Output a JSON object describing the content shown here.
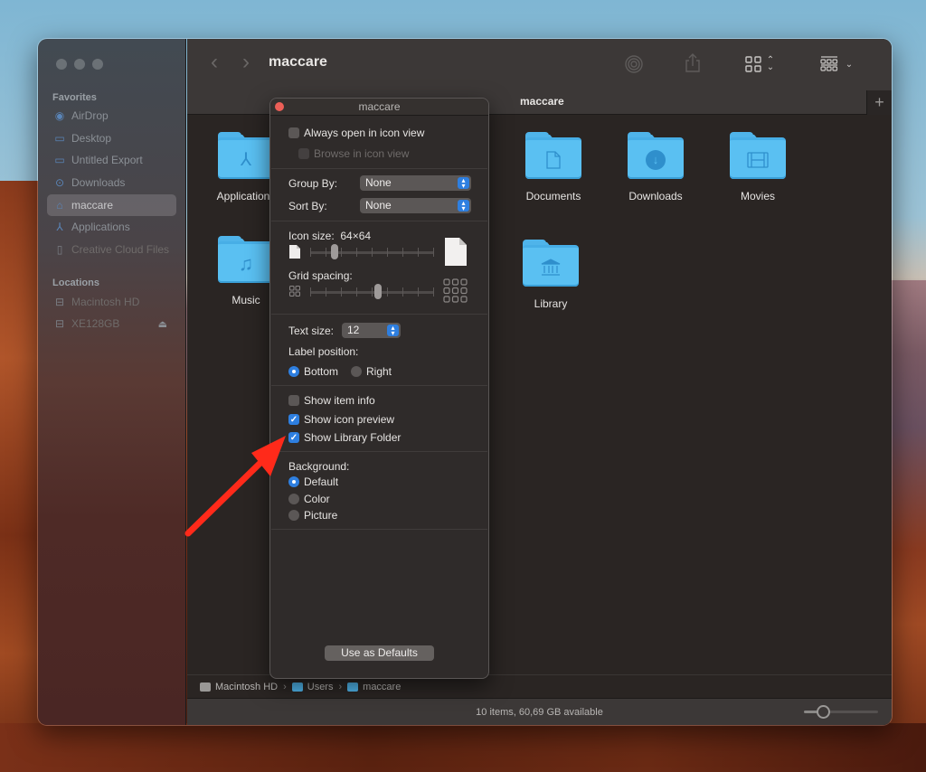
{
  "window": {
    "title": "maccare",
    "tab_title": "maccare"
  },
  "sidebar": {
    "favorites_heading": "Favorites",
    "favorites": [
      {
        "label": "AirDrop",
        "icon": "airdrop-icon"
      },
      {
        "label": "Desktop",
        "icon": "desktop-icon"
      },
      {
        "label": "Untitled Export",
        "icon": "folder-icon"
      },
      {
        "label": "Downloads",
        "icon": "downloads-icon"
      },
      {
        "label": "maccare",
        "icon": "home-icon",
        "selected": true
      },
      {
        "label": "Applications",
        "icon": "applications-icon"
      },
      {
        "label": "Creative Cloud Files",
        "icon": "document-icon"
      }
    ],
    "locations_heading": "Locations",
    "locations": [
      {
        "label": "Macintosh HD",
        "icon": "disk-icon"
      },
      {
        "label": "XE128GB",
        "icon": "disk-icon",
        "eject": true
      }
    ]
  },
  "toolbar": {
    "back": "‹",
    "forward": "›",
    "icons": [
      "airdrop-icon",
      "share-icon",
      "icon-view-icon",
      "group-icon",
      "search-icon"
    ]
  },
  "items": [
    {
      "label": "Applications",
      "glyph": "A"
    },
    {
      "label": "Documents",
      "glyph": "doc"
    },
    {
      "label": "Downloads",
      "glyph": "↓"
    },
    {
      "label": "Movies",
      "glyph": "film"
    },
    {
      "label": "Music",
      "glyph": "♫"
    },
    {
      "label": "Library",
      "glyph": "bank"
    }
  ],
  "view_options": {
    "title": "maccare",
    "always_open_icon_view": {
      "label": "Always open in icon view",
      "checked": false
    },
    "browse_icon_view": {
      "label": "Browse in icon view",
      "checked": false,
      "disabled": true
    },
    "group_by": {
      "label": "Group By:",
      "value": "None"
    },
    "sort_by": {
      "label": "Sort By:",
      "value": "None"
    },
    "icon_size": {
      "label": "Icon size:",
      "value": "64×64",
      "slider_fraction": 0.2
    },
    "grid_spacing": {
      "label": "Grid spacing:",
      "slider_fraction": 0.55
    },
    "text_size": {
      "label": "Text size:",
      "value": "12"
    },
    "label_position": {
      "label": "Label position:",
      "options": [
        "Bottom",
        "Right"
      ],
      "selected": "Bottom"
    },
    "show_item_info": {
      "label": "Show item info",
      "checked": false
    },
    "show_icon_preview": {
      "label": "Show icon preview",
      "checked": true
    },
    "show_library_folder": {
      "label": "Show Library Folder",
      "checked": true
    },
    "background": {
      "label": "Background:",
      "options": [
        "Default",
        "Color",
        "Picture"
      ],
      "selected": "Default"
    },
    "use_defaults_label": "Use as Defaults"
  },
  "pathbar": [
    "Macintosh HD",
    "Users",
    "maccare"
  ],
  "status": {
    "text": "10 items, 60,69 GB available",
    "zoom_fraction": 0.25
  },
  "annotation": {
    "arrow_color": "#ff2a1a"
  }
}
